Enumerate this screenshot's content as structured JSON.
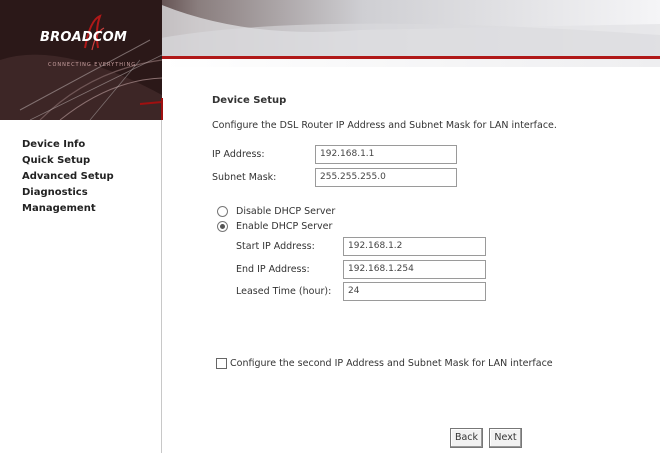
{
  "brand": {
    "logo_text": "BROADCOM",
    "logo_sub": "CONNECTING EVERYTHING"
  },
  "colors": {
    "banner_dark": "#3a2020",
    "accent_red": "#b01818",
    "bg": "#ffffff"
  },
  "sidebar": {
    "items": [
      {
        "label": "Device Info"
      },
      {
        "label": "Quick Setup"
      },
      {
        "label": "Advanced Setup"
      },
      {
        "label": "Diagnostics"
      },
      {
        "label": "Management"
      }
    ]
  },
  "main": {
    "title": "Device Setup",
    "description": "Configure the DSL Router IP Address and Subnet Mask for LAN interface.",
    "ip_address_label": "IP Address:",
    "ip_address_value": "192.168.1.1",
    "subnet_mask_label": "Subnet Mask:",
    "subnet_mask_value": "255.255.255.0",
    "dhcp": {
      "disable_label": "Disable DHCP Server",
      "enable_label": "Enable DHCP Server",
      "selected": "enable",
      "start_ip_label": "Start IP Address:",
      "start_ip_value": "192.168.1.2",
      "end_ip_label": "End IP Address:",
      "end_ip_value": "192.168.1.254",
      "lease_label": "Leased Time (hour):",
      "lease_value": "24"
    },
    "second_ip_label": "Configure the second IP Address and Subnet Mask for LAN interface",
    "second_ip_checked": false,
    "back_label": "Back",
    "next_label": "Next"
  }
}
